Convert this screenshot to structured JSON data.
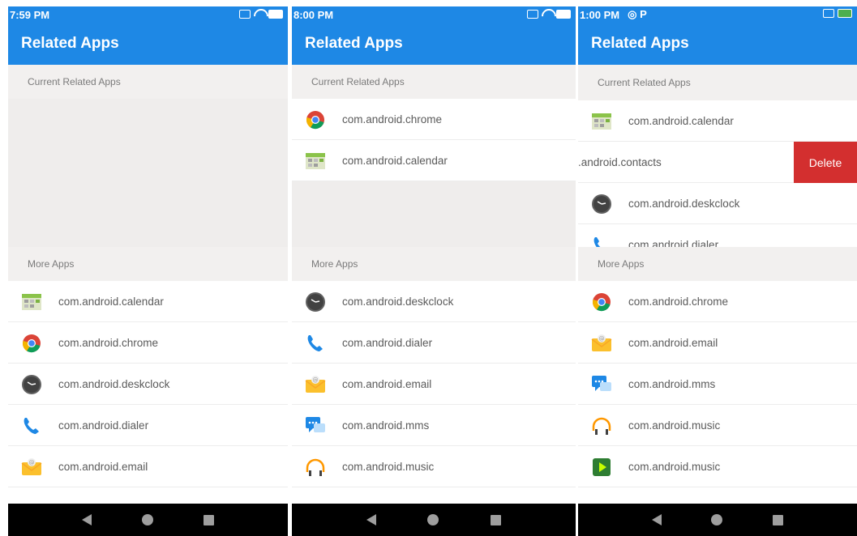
{
  "title": "Related Apps",
  "current_header": "Current Related Apps",
  "more_header": "More Apps",
  "delete_label": "Delete",
  "colors": {
    "accent": "#1e88e5",
    "delete": "#d32f2f",
    "header_bg": "#f2f0ef"
  },
  "screens": [
    {
      "time": "7:59 PM",
      "current": [],
      "more": [
        {
          "label": "com.android.calendar",
          "icon": "calendar-icon"
        },
        {
          "label": "com.android.chrome",
          "icon": "chrome-icon"
        },
        {
          "label": "com.android.deskclock",
          "icon": "clock-icon"
        },
        {
          "label": "com.android.dialer",
          "icon": "phone-icon"
        },
        {
          "label": "com.android.email",
          "icon": "email-icon"
        }
      ]
    },
    {
      "time": "8:00 PM",
      "current": [
        {
          "label": "com.android.chrome",
          "icon": "chrome-icon"
        },
        {
          "label": "com.android.calendar",
          "icon": "calendar-icon"
        }
      ],
      "more": [
        {
          "label": "com.android.deskclock",
          "icon": "clock-icon"
        },
        {
          "label": "com.android.dialer",
          "icon": "phone-icon"
        },
        {
          "label": "com.android.email",
          "icon": "email-icon"
        },
        {
          "label": "com.android.mms",
          "icon": "mms-icon"
        },
        {
          "label": "com.android.music",
          "icon": "headphones-icon"
        }
      ]
    },
    {
      "time": "1:00 PM",
      "current": [
        {
          "label": "com.android.calendar",
          "icon": "calendar-icon"
        },
        {
          "label": ".android.contacts",
          "icon": "contacts-icon"
        },
        {
          "label": "com.android.deskclock",
          "icon": "clock-icon"
        },
        {
          "label": "com.android.dialer",
          "icon": "phone-icon"
        }
      ],
      "more": [
        {
          "label": "com.android.chrome",
          "icon": "chrome-icon"
        },
        {
          "label": "com.android.email",
          "icon": "email-icon"
        },
        {
          "label": "com.android.mms",
          "icon": "mms-icon"
        },
        {
          "label": "com.android.music",
          "icon": "headphones-icon"
        },
        {
          "label": "com.android.music",
          "icon": "play-icon"
        }
      ]
    }
  ]
}
